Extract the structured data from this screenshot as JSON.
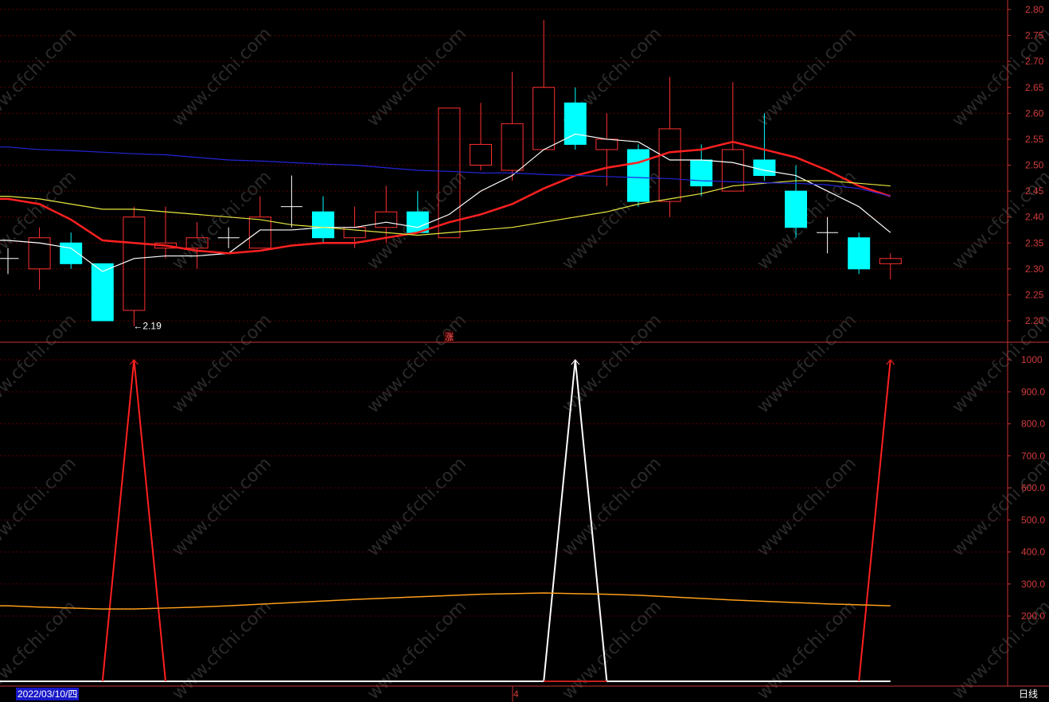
{
  "chart_data": [
    {
      "type": "candlestick",
      "ylim": [
        2.17,
        2.81
      ],
      "y_ticks": [
        "2.80",
        "2.75",
        "2.70",
        "2.65",
        "2.60",
        "2.55",
        "2.50",
        "2.45",
        "2.40",
        "2.35",
        "2.30",
        "2.25",
        "2.20"
      ],
      "low_annotation": "←2.19",
      "marker_label": "涨",
      "candles": [
        {
          "o": 2.32,
          "h": 2.34,
          "l": 2.29,
          "c": 2.32
        },
        {
          "o": 2.3,
          "h": 2.38,
          "l": 2.26,
          "c": 2.36
        },
        {
          "o": 2.35,
          "h": 2.37,
          "l": 2.3,
          "c": 2.31
        },
        {
          "o": 2.31,
          "h": 2.31,
          "l": 2.2,
          "c": 2.2
        },
        {
          "o": 2.22,
          "h": 2.42,
          "l": 2.19,
          "c": 2.4
        },
        {
          "o": 2.34,
          "h": 2.42,
          "l": 2.32,
          "c": 2.35
        },
        {
          "o": 2.34,
          "h": 2.39,
          "l": 2.3,
          "c": 2.36
        },
        {
          "o": 2.36,
          "h": 2.38,
          "l": 2.34,
          "c": 2.36
        },
        {
          "o": 2.34,
          "h": 2.44,
          "l": 2.34,
          "c": 2.4
        },
        {
          "o": 2.42,
          "h": 2.48,
          "l": 2.38,
          "c": 2.42
        },
        {
          "o": 2.41,
          "h": 2.44,
          "l": 2.35,
          "c": 2.36
        },
        {
          "o": 2.36,
          "h": 2.42,
          "l": 2.34,
          "c": 2.38
        },
        {
          "o": 2.38,
          "h": 2.46,
          "l": 2.35,
          "c": 2.41
        },
        {
          "o": 2.41,
          "h": 2.45,
          "l": 2.37,
          "c": 2.37
        },
        {
          "o": 2.36,
          "h": 2.61,
          "l": 2.36,
          "c": 2.61
        },
        {
          "o": 2.5,
          "h": 2.62,
          "l": 2.49,
          "c": 2.54
        },
        {
          "o": 2.49,
          "h": 2.68,
          "l": 2.47,
          "c": 2.58
        },
        {
          "o": 2.53,
          "h": 2.78,
          "l": 2.53,
          "c": 2.65
        },
        {
          "o": 2.62,
          "h": 2.65,
          "l": 2.53,
          "c": 2.54
        },
        {
          "o": 2.53,
          "h": 2.6,
          "l": 2.46,
          "c": 2.55
        },
        {
          "o": 2.53,
          "h": 2.54,
          "l": 2.42,
          "c": 2.43
        },
        {
          "o": 2.43,
          "h": 2.67,
          "l": 2.4,
          "c": 2.57
        },
        {
          "o": 2.51,
          "h": 2.54,
          "l": 2.44,
          "c": 2.46
        },
        {
          "o": 2.45,
          "h": 2.66,
          "l": 2.45,
          "c": 2.53
        },
        {
          "o": 2.51,
          "h": 2.6,
          "l": 2.47,
          "c": 2.48
        },
        {
          "o": 2.45,
          "h": 2.5,
          "l": 2.36,
          "c": 2.38
        },
        {
          "o": 2.37,
          "h": 2.4,
          "l": 2.33,
          "c": 2.37
        },
        {
          "o": 2.36,
          "h": 2.37,
          "l": 2.29,
          "c": 2.3
        },
        {
          "o": 2.31,
          "h": 2.33,
          "l": 2.28,
          "c": 2.32
        }
      ],
      "moving_averages": [
        {
          "color": "#ffffff",
          "values": [
            2.355,
            2.35,
            2.34,
            2.295,
            2.32,
            2.325,
            2.325,
            2.33,
            2.375,
            2.375,
            2.38,
            2.38,
            2.39,
            2.38,
            2.405,
            2.45,
            2.48,
            2.53,
            2.56,
            2.55,
            2.545,
            2.51,
            2.51,
            2.505,
            2.49,
            2.48,
            2.45,
            2.42,
            2.37
          ]
        },
        {
          "color": "#ff2020",
          "values": [
            2.435,
            2.425,
            2.395,
            2.355,
            2.35,
            2.345,
            2.335,
            2.33,
            2.335,
            2.345,
            2.35,
            2.35,
            2.36,
            2.37,
            2.39,
            2.405,
            2.425,
            2.455,
            2.48,
            2.495,
            2.505,
            2.525,
            2.53,
            2.545,
            2.53,
            2.515,
            2.49,
            2.46,
            2.44
          ]
        },
        {
          "color": "#e8e840",
          "values": [
            2.44,
            2.435,
            2.425,
            2.415,
            2.415,
            2.41,
            2.405,
            2.4,
            2.395,
            2.385,
            2.38,
            2.375,
            2.37,
            2.365,
            2.37,
            2.375,
            2.38,
            2.39,
            2.4,
            2.41,
            2.425,
            2.435,
            2.445,
            2.46,
            2.465,
            2.47,
            2.47,
            2.465,
            2.46
          ]
        },
        {
          "color": "#2424d8",
          "values": [
            2.535,
            2.53,
            2.528,
            2.525,
            2.522,
            2.52,
            2.515,
            2.51,
            2.508,
            2.505,
            2.502,
            2.5,
            2.495,
            2.49,
            2.488,
            2.485,
            2.485,
            2.482,
            2.48,
            2.478,
            2.476,
            2.474,
            2.47,
            2.468,
            2.466,
            2.465,
            2.462,
            2.455,
            2.44
          ]
        }
      ]
    },
    {
      "type": "line",
      "ylim": [
        0,
        1000
      ],
      "y_ticks": [
        "1000",
        "900.0",
        "800.0",
        "700.0",
        "600.0",
        "500.0",
        "400.0",
        "300.0",
        "200.0"
      ],
      "signal": [
        0,
        0,
        0,
        0,
        1000,
        0,
        0,
        0,
        0,
        0,
        0,
        0,
        0,
        0,
        0,
        0,
        0,
        0,
        1000,
        0,
        0,
        0,
        0,
        0,
        0,
        0,
        0,
        0,
        1000
      ],
      "signal_colors": [
        "#ff2020",
        "#ffffff",
        "#ff2020"
      ],
      "average_line": {
        "color": "#ff9e1a",
        "values": [
          232,
          228,
          225,
          222,
          222,
          225,
          228,
          232,
          237,
          242,
          247,
          252,
          256,
          260,
          264,
          268,
          270,
          272,
          270,
          268,
          265,
          260,
          255,
          250,
          246,
          242,
          238,
          235,
          232
        ]
      }
    }
  ],
  "footer": {
    "date": "2022/03/10/四",
    "middle": "4",
    "period": "日线"
  },
  "watermark": "www.cfchi.com"
}
